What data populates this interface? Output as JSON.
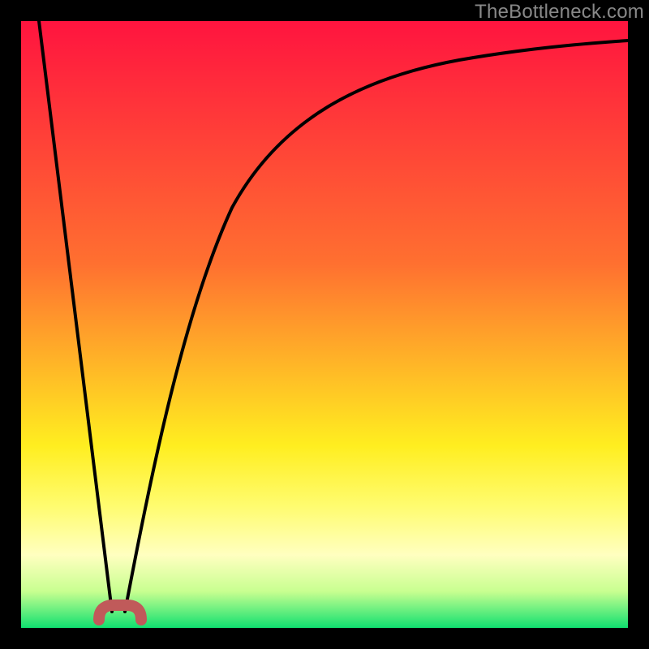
{
  "watermark": "TheBottleneck.com",
  "chart_data": {
    "type": "line",
    "title": "",
    "xlabel": "",
    "ylabel": "",
    "xlim": [
      0,
      100
    ],
    "ylim": [
      0,
      100
    ],
    "grid": false,
    "background": {
      "type": "vertical-gradient",
      "stops": [
        {
          "pos": 0,
          "color": "#ff143f"
        },
        {
          "pos": 40,
          "color": "#ff7030"
        },
        {
          "pos": 70,
          "color": "#ffee20"
        },
        {
          "pos": 80,
          "color": "#fffc70"
        },
        {
          "pos": 88,
          "color": "#ffffc0"
        },
        {
          "pos": 94,
          "color": "#c8ff90"
        },
        {
          "pos": 100,
          "color": "#10e070"
        }
      ]
    },
    "annotations": [
      {
        "type": "marker",
        "shape": "rounded-bridge",
        "cx": 15,
        "cy": 97,
        "color": "#c05a5a"
      }
    ],
    "series": [
      {
        "name": "left-descent",
        "x": [
          3,
          15
        ],
        "y": [
          100,
          3
        ],
        "note": "straight line falling from top-left to marker"
      },
      {
        "name": "right-curve",
        "x": [
          17,
          20,
          24,
          28,
          33,
          38,
          45,
          55,
          65,
          75,
          85,
          95,
          100
        ],
        "y": [
          3,
          20,
          38,
          52,
          63,
          71,
          78,
          84,
          88,
          90.5,
          92.5,
          93.8,
          94.5
        ],
        "note": "steeply rising curve that flattens toward the right"
      }
    ]
  }
}
